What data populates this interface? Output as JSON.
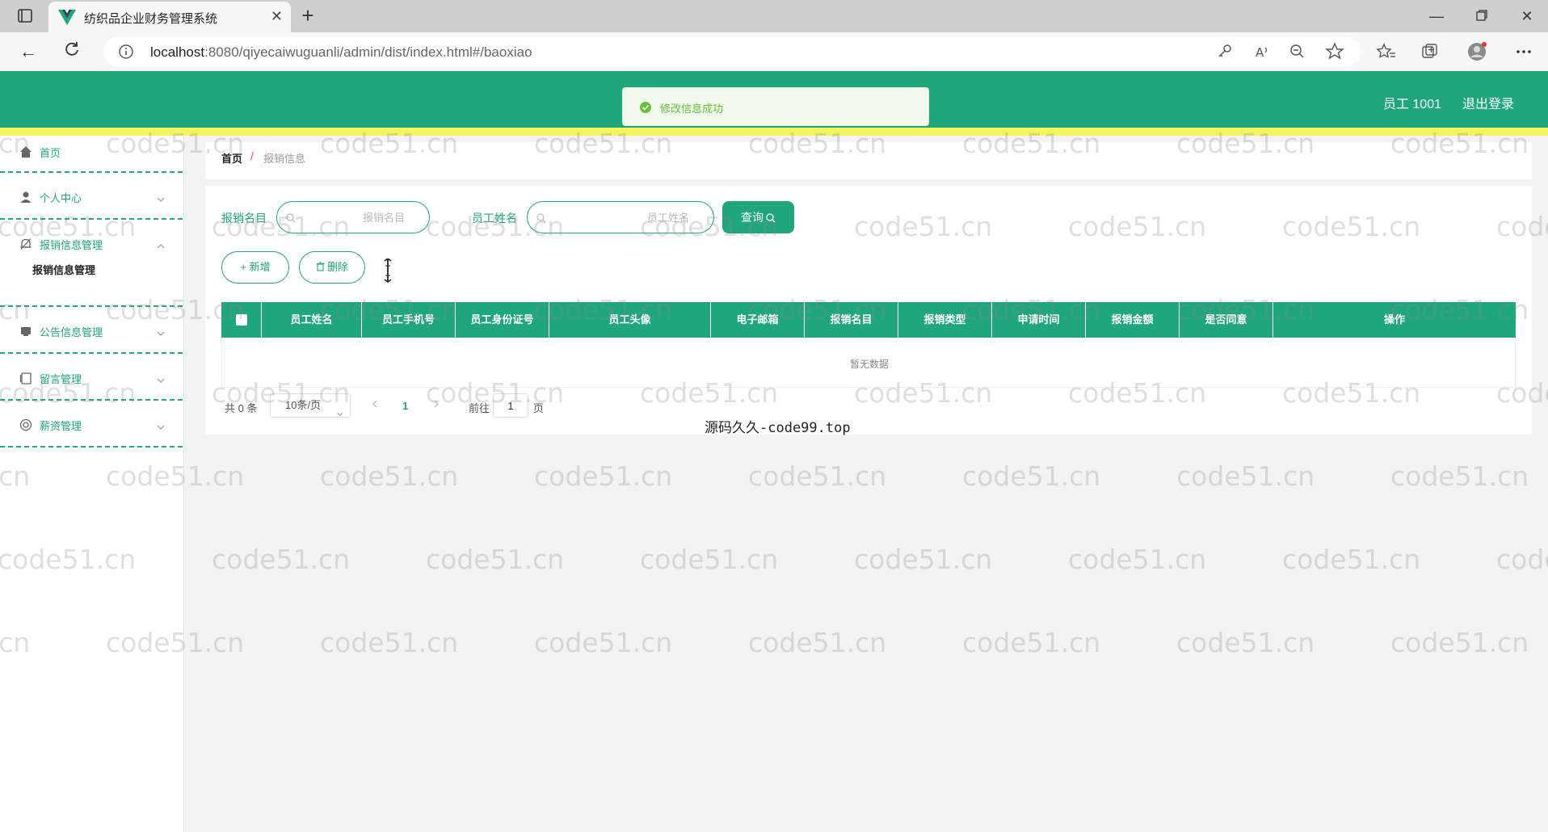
{
  "browser": {
    "tab_title": "纺织品企业财务管理系统",
    "url_host": "localhost",
    "url_rest": ":8080/qiyecaiwuguanli/admin/dist/index.html#/baoxiao"
  },
  "header": {
    "user": "员工 1001",
    "logout": "退出登录"
  },
  "toast": {
    "message": "修改信息成功"
  },
  "sidebar": {
    "items": [
      {
        "label": "首页",
        "icon": "home-icon"
      },
      {
        "label": "个人中心",
        "icon": "user-icon"
      },
      {
        "label": "报销信息管理",
        "icon": "bell-icon",
        "expanded": true,
        "children": [
          "报销信息管理"
        ]
      },
      {
        "label": "公告信息管理",
        "icon": "notice-icon"
      },
      {
        "label": "留言管理",
        "icon": "message-icon"
      },
      {
        "label": "薪资管理",
        "icon": "salary-icon"
      }
    ]
  },
  "breadcrumb": {
    "home": "首页",
    "separator": "/",
    "current": "报销信息"
  },
  "search": {
    "field1_label": "报销名目",
    "field1_placeholder": "报销名目",
    "field2_label": "员工姓名",
    "field2_placeholder": "员工姓名",
    "query_button": "查询"
  },
  "actions": {
    "add": "+ 新增",
    "delete": "删除"
  },
  "table": {
    "columns": [
      "员工姓名",
      "员工手机号",
      "员工身份证号",
      "员工头像",
      "电子邮箱",
      "报销名目",
      "报销类型",
      "申请时间",
      "报销金额",
      "是否同意",
      "操作"
    ],
    "empty_text": "暂无数据"
  },
  "pagination": {
    "total": "共 0 条",
    "page_size": "10条/页",
    "current_page": "1",
    "goto_label": "前往",
    "goto_value": "1",
    "page_suffix": "页"
  },
  "source_note": "源码久久-code99.top",
  "watermark": "code51.cn",
  "colors": {
    "primary": "#1fa67a",
    "header_accent": "#f2f560",
    "toast_bg": "#f0f9eb",
    "toast_text": "#67c23a"
  }
}
